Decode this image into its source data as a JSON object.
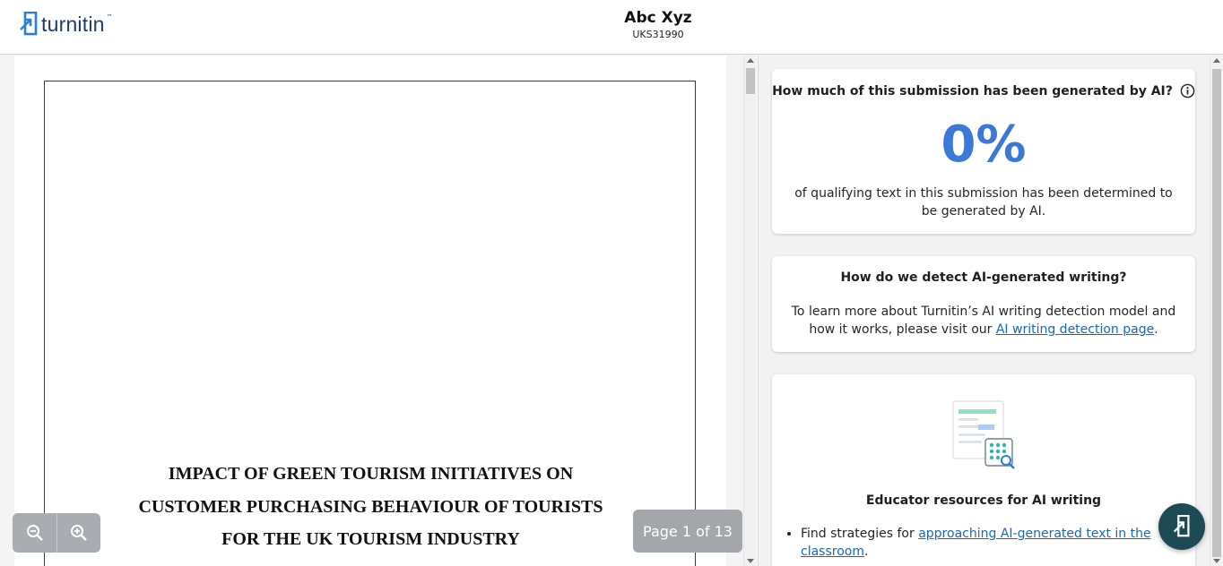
{
  "app": {
    "logo_text": "turnitin",
    "logo_tm": "™",
    "brand_color": "#1d3b6e"
  },
  "header": {
    "student_name": "Abc Xyz",
    "submission_id": "UKS31990"
  },
  "document": {
    "title_lines": [
      "IMPACT OF GREEN TOURISM INITIATIVES ON",
      "CUSTOMER PURCHASING BEHAVIOUR OF TOURISTS",
      "FOR THE UK TOURISM INDUSTRY"
    ],
    "page_indicator": "Page 1 of 13",
    "current_page": 1,
    "total_pages": 13
  },
  "toolbar": {
    "zoom_out_icon": "zoom-out-icon",
    "zoom_in_icon": "zoom-in-icon"
  },
  "ai_score": {
    "question": "How much of this submission has been generated by AI?",
    "percent": "0%",
    "description": "of qualifying text in this submission has been determined to be generated by AI.",
    "accent_color": "#3b78d8"
  },
  "detection_info": {
    "heading": "How do we detect AI-generated writing?",
    "text_before_link": "To learn more about Turnitin’s AI writing detection model and how it works, please visit our ",
    "link_text": "AI writing detection page",
    "text_after_link": "."
  },
  "educator_resources": {
    "heading": "Educator resources for AI writing",
    "items": [
      {
        "prefix": "Find strategies for ",
        "link": "approaching AI-generated text in the classroom",
        "suffix": "."
      }
    ]
  },
  "help": {
    "icon": "help-chat-icon"
  }
}
